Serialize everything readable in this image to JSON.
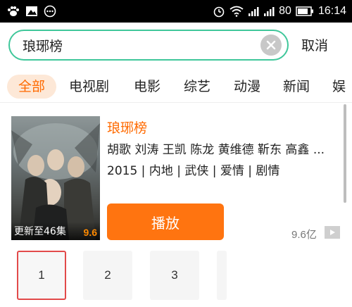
{
  "status_bar": {
    "left_icons": [
      "paw-icon",
      "image-icon",
      "message-icon"
    ],
    "right_icons": [
      "alarm-icon",
      "wifi-icon",
      "signal-icon",
      "signal-icon-2"
    ],
    "battery": "80",
    "time": "16:14"
  },
  "search": {
    "value": "琅琊榜",
    "clear_icon": "clear-icon",
    "cancel_label": "取消",
    "accent_color": "#3fc79a"
  },
  "tabs": [
    {
      "label": "全部",
      "active": true
    },
    {
      "label": "电视剧"
    },
    {
      "label": "电影"
    },
    {
      "label": "综艺"
    },
    {
      "label": "动漫"
    },
    {
      "label": "新闻"
    },
    {
      "label": "娱"
    }
  ],
  "result": {
    "title": "琅琊榜",
    "cast": "胡歌 刘涛 王凯 陈龙 黄维德 靳东 高鑫 ...",
    "meta": "2015 | 内地 | 武侠 | 爱情 | 剧情",
    "poster_update": "更新至46集",
    "poster_score": "9.6",
    "play_label": "播放",
    "views": "9.6亿",
    "play_color": "#ff7410"
  },
  "episodes": [
    {
      "label": "1",
      "selected": true
    },
    {
      "label": "2"
    },
    {
      "label": "3"
    }
  ]
}
